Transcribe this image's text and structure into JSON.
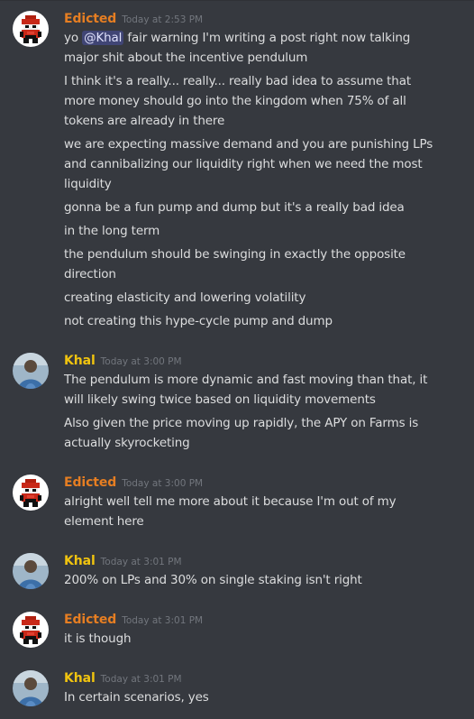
{
  "users": {
    "edicted": {
      "name": "Edicted",
      "color": "#e67e22",
      "avatar_icon": "pixel-art-character-avatar"
    },
    "khal": {
      "name": "Khal",
      "color": "#f1c40f",
      "avatar_icon": "photo-avatar"
    }
  },
  "messages": [
    {
      "author": "Edicted",
      "timestamp": "Today at 2:53 PM",
      "lines": [
        {
          "prefix": "yo ",
          "mention": "@Khal",
          "suffix": " fair warning I'm writing a post right now talking"
        },
        {
          "text": "major shit about the incentive pendulum"
        },
        {
          "text": "I think it's a really... really... really bad idea to assume that"
        },
        {
          "text": "more money should go into the kingdom when 75% of all"
        },
        {
          "text": "tokens are already in there"
        },
        {
          "text": "we are expecting massive demand and you are punishing LPs"
        },
        {
          "text": "and cannibalizing our liquidity right when we need the most"
        },
        {
          "text": "liquidity"
        },
        {
          "text": "gonna be a fun pump and dump but it's a really bad idea"
        },
        {
          "text": "in the long term"
        },
        {
          "text": "the pendulum should be swinging in exactly the opposite"
        },
        {
          "text": "direction"
        },
        {
          "text": "creating elasticity and lowering volatility"
        },
        {
          "text": "not creating this hype-cycle pump and dump"
        }
      ]
    },
    {
      "author": "Khal",
      "timestamp": "Today at 3:00 PM",
      "lines": [
        {
          "text": "The pendulum is more dynamic and fast moving than that, it"
        },
        {
          "text": "will likely swing twice based on liquidity movements"
        },
        {
          "text": "Also given the price moving up rapidly, the APY on Farms is"
        },
        {
          "text": "actually skyrocketing"
        }
      ]
    },
    {
      "author": "Edicted",
      "timestamp": "Today at 3:00 PM",
      "lines": [
        {
          "text": "alright well tell me more about it because I'm out of my"
        },
        {
          "text": "element here"
        }
      ]
    },
    {
      "author": "Khal",
      "timestamp": "Today at 3:01 PM",
      "lines": [
        {
          "text": "200% on LPs and 30% on single staking isn't right"
        }
      ]
    },
    {
      "author": "Edicted",
      "timestamp": "Today at 3:01 PM",
      "lines": [
        {
          "text": "it is though"
        }
      ]
    },
    {
      "author": "Khal",
      "timestamp": "Today at 3:01 PM",
      "lines": [
        {
          "text": "In certain scenarios, yes"
        }
      ]
    }
  ]
}
